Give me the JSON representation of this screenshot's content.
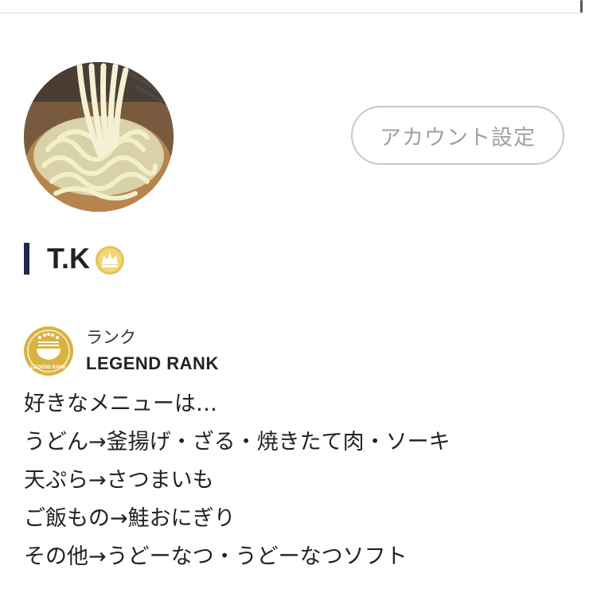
{
  "profile": {
    "avatar": {
      "icon": "udon-noodles-photo"
    },
    "account_settings_label": "アカウント設定",
    "name": "T.K",
    "badge_icon": "gold-crown-badge-icon"
  },
  "rank": {
    "label": "ランク",
    "name": "LEGEND RANK",
    "medal_icon": "legend-rank-medal-icon",
    "medal_text": "LEGEND RANK",
    "color": "#d9b341"
  },
  "bio": {
    "lines": [
      "好きなメニューは…",
      "うどん→釜揚げ・ざる・焼きたて肉・ソーキ",
      "天ぷら→さつまいも",
      "ご飯もの→鮭おにぎり",
      "その他→うどーなつ・うどーなつソフト"
    ]
  },
  "colors": {
    "accent_bar": "#1e2a4a",
    "gold": "#d9b341",
    "button_border": "#c8c8c8",
    "button_text": "#a0a0a0"
  }
}
